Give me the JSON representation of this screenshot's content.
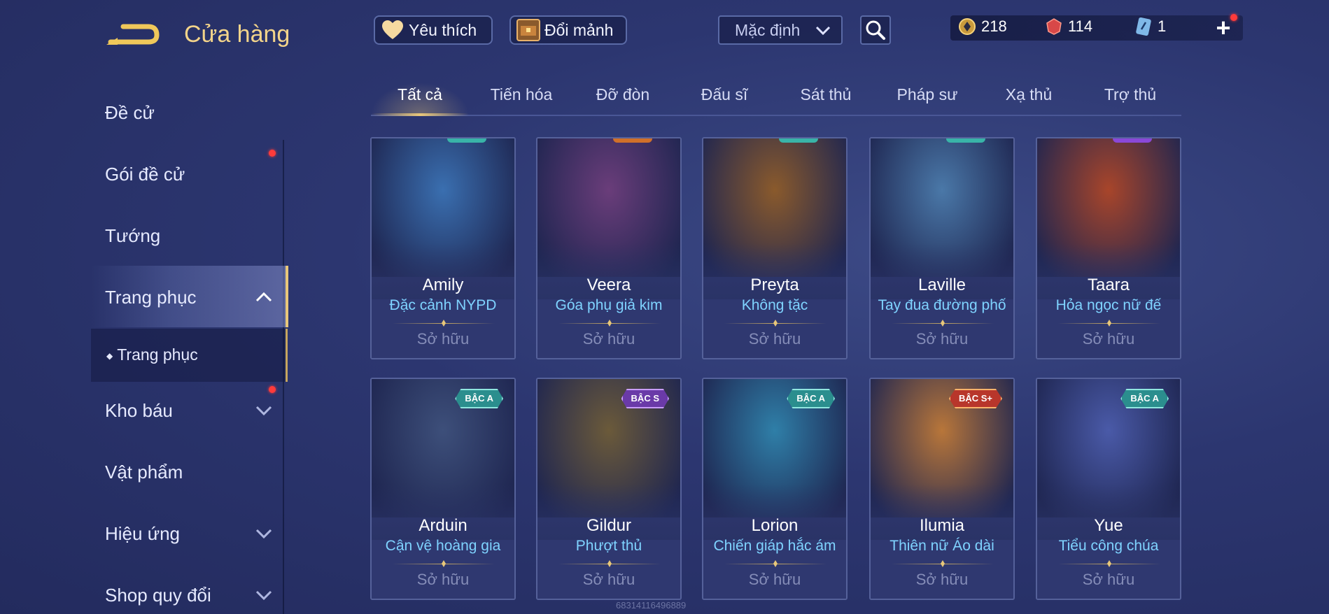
{
  "header": {
    "title": "Cửa hàng",
    "favorites_label": "Yêu thích",
    "exchange_label": "Đổi mảnh",
    "sort_value": "Mặc định"
  },
  "currency": {
    "gold": "218",
    "gems": "114",
    "vouchers": "1"
  },
  "sidebar": {
    "items": [
      {
        "label": "Đề cử"
      },
      {
        "label": "Gói đề cử"
      },
      {
        "label": "Tướng"
      },
      {
        "label": "Trang phục"
      },
      {
        "label": "Trang phục"
      },
      {
        "label": "Kho báu"
      },
      {
        "label": "Vật phẩm"
      },
      {
        "label": "Hiệu ứng"
      },
      {
        "label": "Shop quy đổi"
      }
    ]
  },
  "tabs": [
    {
      "label": "Tất cả"
    },
    {
      "label": "Tiến hóa"
    },
    {
      "label": "Đỡ đòn"
    },
    {
      "label": "Đấu sĩ"
    },
    {
      "label": "Sát thủ"
    },
    {
      "label": "Pháp sư"
    },
    {
      "label": "Xạ thủ"
    },
    {
      "label": "Trợ thủ"
    }
  ],
  "cards": [
    {
      "hero": "Amily",
      "skin": "Đặc cảnh NYPD",
      "status": "Sở hữu",
      "color": "#3a6fb0"
    },
    {
      "hero": "Veera",
      "skin": "Góa phụ giả kim",
      "status": "Sở hữu",
      "color": "#6a3d7a"
    },
    {
      "hero": "Preyta",
      "skin": "Không tặc",
      "status": "Sở hữu",
      "color": "#8a5a2c"
    },
    {
      "hero": "Laville",
      "skin": "Tay đua đường phố",
      "status": "Sở hữu",
      "color": "#4a78a8"
    },
    {
      "hero": "Taara",
      "skin": "Hỏa ngọc nữ đế",
      "status": "Sở hữu",
      "color": "#a8452a"
    },
    {
      "hero": "Arduin",
      "skin": "Cận vệ hoàng gia",
      "status": "Sở hữu",
      "badge": "BẬC A",
      "color": "#3d4f7a"
    },
    {
      "hero": "Gildur",
      "skin": "Phượt thủ",
      "status": "Sở hữu",
      "badge": "BẬC S",
      "color": "#6b5a3a"
    },
    {
      "hero": "Lorion",
      "skin": "Chiến giáp hắc ám",
      "status": "Sở hữu",
      "badge": "BẬC A",
      "color": "#2f7fa8"
    },
    {
      "hero": "Ilumia",
      "skin": "Thiên nữ Áo dài",
      "status": "Sở hữu",
      "badge": "BẬC S+",
      "color": "#b8763a"
    },
    {
      "hero": "Yue",
      "skin": "Tiểu công chúa",
      "status": "Sở hữu",
      "badge": "BẬC A",
      "color": "#4a5aa8"
    }
  ],
  "watermark": "68314116496889"
}
